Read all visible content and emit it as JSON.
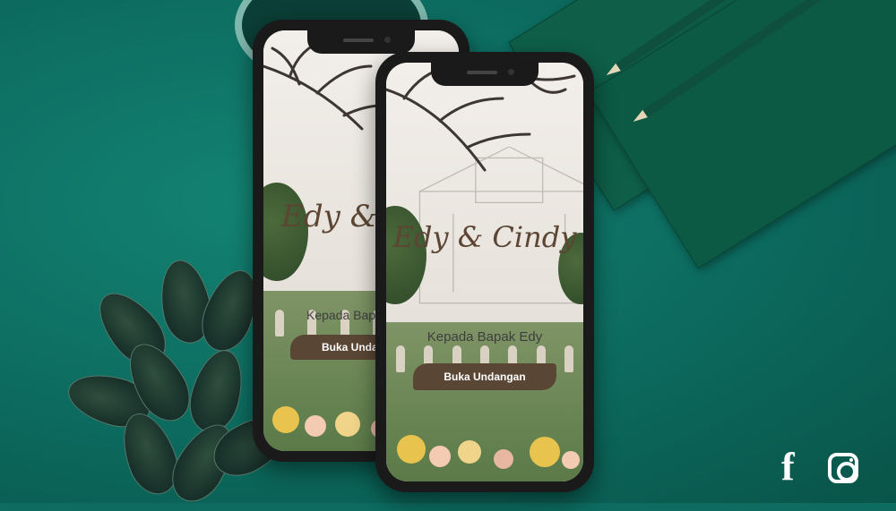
{
  "background_color": "#0d6b5f",
  "invitation": {
    "couple_names": "Edy & Cindy",
    "couple_names_cropped": "Edy & C",
    "greeting": "Kepada Bapak Edy",
    "greeting_cropped": "Kepada Bap",
    "open_button_label": "Buka Undangan",
    "open_button_label_cropped": "Buka Undan",
    "accent_color": "#5a4634"
  },
  "social": {
    "facebook_icon": "facebook-icon",
    "instagram_icon": "instagram-icon"
  }
}
